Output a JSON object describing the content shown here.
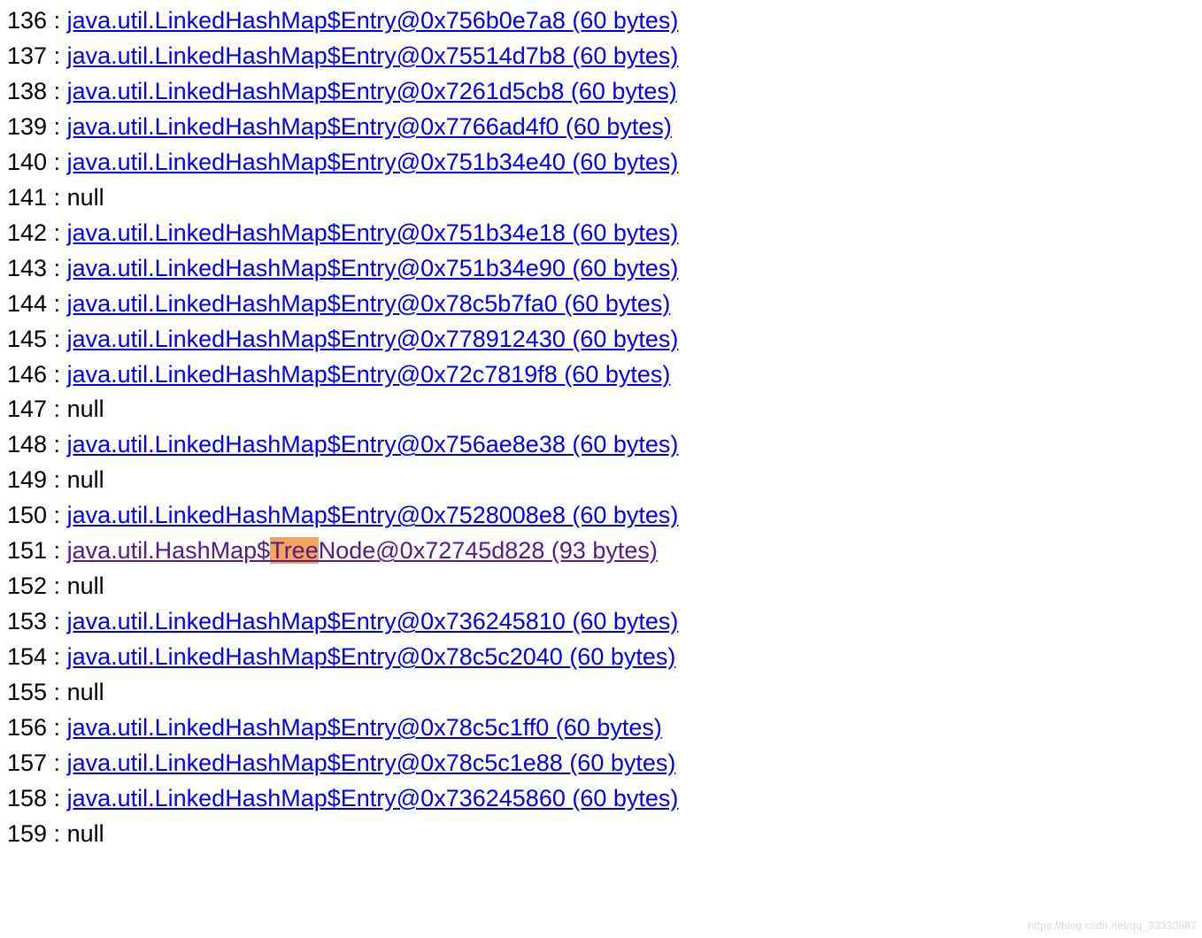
{
  "highlight_term": "Tree",
  "watermark": "https://blog.csdn.net/qq_33330687",
  "rows": [
    {
      "index": "136",
      "type": "link",
      "text": "java.util.LinkedHashMap$Entry@0x756b0e7a8 (60 bytes)"
    },
    {
      "index": "137",
      "type": "link",
      "text": "java.util.LinkedHashMap$Entry@0x75514d7b8 (60 bytes)"
    },
    {
      "index": "138",
      "type": "link",
      "text": "java.util.LinkedHashMap$Entry@0x7261d5cb8 (60 bytes)"
    },
    {
      "index": "139",
      "type": "link",
      "text": "java.util.LinkedHashMap$Entry@0x7766ad4f0 (60 bytes)"
    },
    {
      "index": "140",
      "type": "link",
      "text": "java.util.LinkedHashMap$Entry@0x751b34e40 (60 bytes)"
    },
    {
      "index": "141",
      "type": "null",
      "text": "null"
    },
    {
      "index": "142",
      "type": "link",
      "text": "java.util.LinkedHashMap$Entry@0x751b34e18 (60 bytes)"
    },
    {
      "index": "143",
      "type": "link",
      "text": "java.util.LinkedHashMap$Entry@0x751b34e90 (60 bytes)"
    },
    {
      "index": "144",
      "type": "link",
      "text": "java.util.LinkedHashMap$Entry@0x78c5b7fa0 (60 bytes)"
    },
    {
      "index": "145",
      "type": "link",
      "text": "java.util.LinkedHashMap$Entry@0x778912430 (60 bytes)"
    },
    {
      "index": "146",
      "type": "link",
      "text": "java.util.LinkedHashMap$Entry@0x72c7819f8 (60 bytes)"
    },
    {
      "index": "147",
      "type": "null",
      "text": "null"
    },
    {
      "index": "148",
      "type": "link",
      "text": "java.util.LinkedHashMap$Entry@0x756ae8e38 (60 bytes)"
    },
    {
      "index": "149",
      "type": "null",
      "text": "null"
    },
    {
      "index": "150",
      "type": "link",
      "text": "java.util.LinkedHashMap$Entry@0x7528008e8 (60 bytes)"
    },
    {
      "index": "151",
      "type": "link-visited",
      "text": "java.util.HashMap$TreeNode@0x72745d828 (93 bytes)"
    },
    {
      "index": "152",
      "type": "null",
      "text": "null"
    },
    {
      "index": "153",
      "type": "link",
      "text": "java.util.LinkedHashMap$Entry@0x736245810 (60 bytes)"
    },
    {
      "index": "154",
      "type": "link",
      "text": "java.util.LinkedHashMap$Entry@0x78c5c2040 (60 bytes)"
    },
    {
      "index": "155",
      "type": "null",
      "text": "null"
    },
    {
      "index": "156",
      "type": "link",
      "text": "java.util.LinkedHashMap$Entry@0x78c5c1ff0 (60 bytes)"
    },
    {
      "index": "157",
      "type": "link",
      "text": "java.util.LinkedHashMap$Entry@0x78c5c1e88 (60 bytes)"
    },
    {
      "index": "158",
      "type": "link",
      "text": "java.util.LinkedHashMap$Entry@0x736245860 (60 bytes)"
    },
    {
      "index": "159",
      "type": "null",
      "text": "null"
    }
  ]
}
